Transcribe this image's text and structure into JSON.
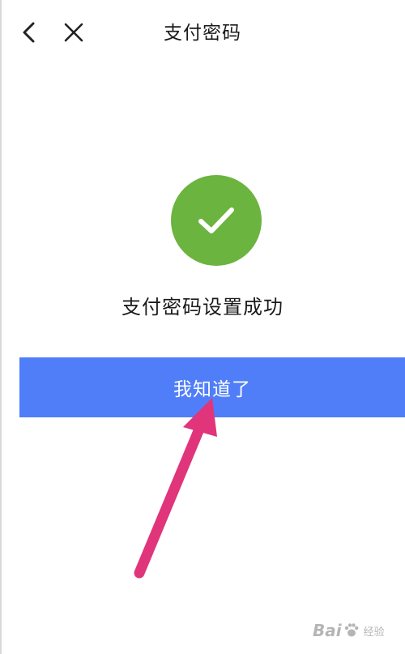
{
  "header": {
    "title": "支付密码",
    "back_icon": "back-arrow-icon",
    "close_icon": "close-icon"
  },
  "success": {
    "icon": "check-circle-icon",
    "icon_color": "#6bb43f",
    "message": "支付密码设置成功"
  },
  "confirm_button": {
    "label": "我知道了",
    "color": "#4f7ef8"
  },
  "annotation": {
    "arrow_color": "#e0357a"
  },
  "watermark": {
    "text_left": "Bai",
    "text_right": "经验"
  }
}
